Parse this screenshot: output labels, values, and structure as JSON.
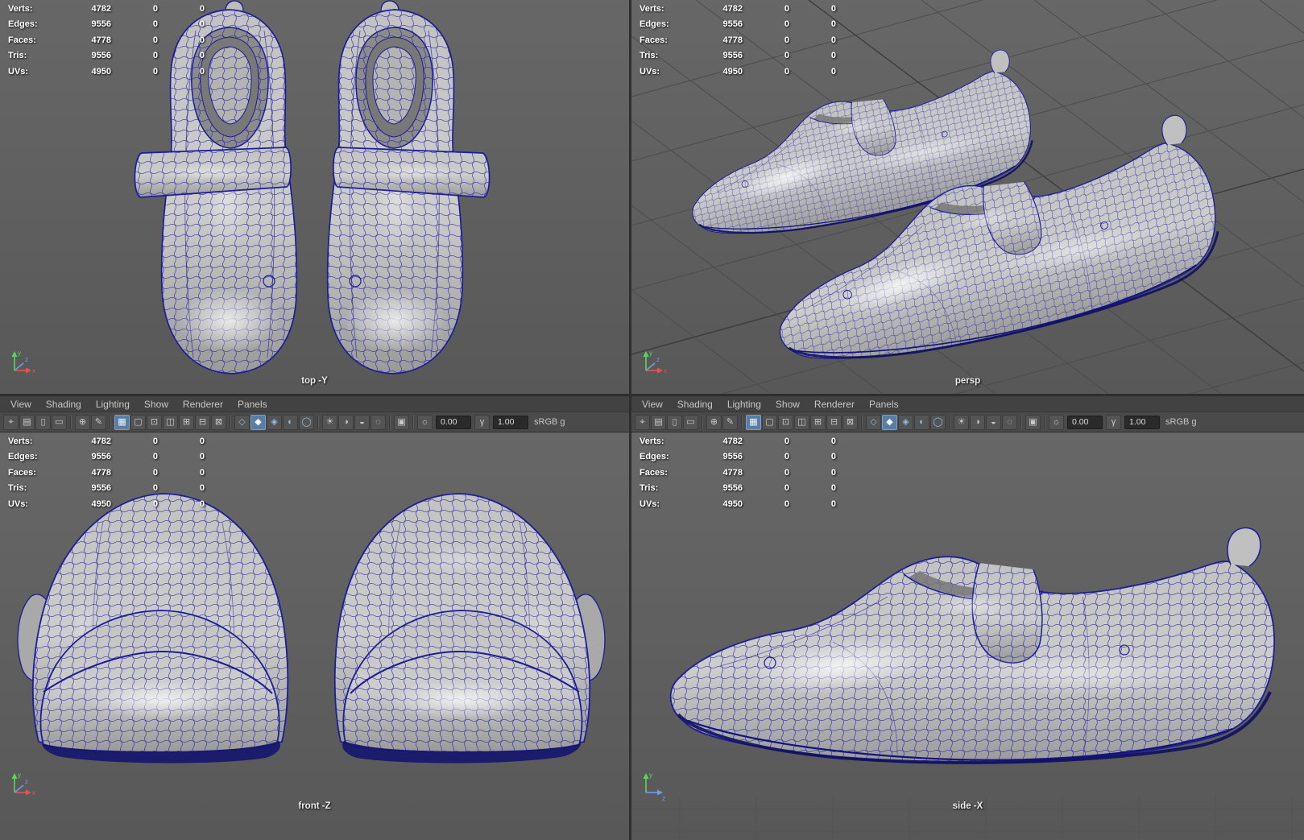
{
  "stats": {
    "rows": [
      {
        "label": "Verts:",
        "total": "4782",
        "selected": "0",
        "other": "0"
      },
      {
        "label": "Edges:",
        "total": "9556",
        "selected": "0",
        "other": "0"
      },
      {
        "label": "Faces:",
        "total": "4778",
        "selected": "0",
        "other": "0"
      },
      {
        "label": "Tris:",
        "total": "9556",
        "selected": "0",
        "other": "0"
      },
      {
        "label": "UVs:",
        "total": "4950",
        "selected": "0",
        "other": "0"
      }
    ]
  },
  "panel_menu": [
    "View",
    "Shading",
    "Lighting",
    "Show",
    "Renderer",
    "Panels"
  ],
  "toolbar": {
    "icons": [
      {
        "name": "select-camera-icon",
        "glyph": "⌖"
      },
      {
        "name": "camera-attributes-icon",
        "glyph": "▤"
      },
      {
        "name": "camera-bookmarks-icon",
        "glyph": "▯"
      },
      {
        "name": "image-plane-icon",
        "glyph": "▭"
      },
      {
        "sep": true
      },
      {
        "name": "two-d-pan-zoom-icon",
        "glyph": "⊕"
      },
      {
        "name": "grease-pencil-icon",
        "glyph": "✎"
      },
      {
        "sep": true
      },
      {
        "name": "grid-icon",
        "glyph": "▦",
        "active": true
      },
      {
        "name": "film-gate-icon",
        "glyph": "▢"
      },
      {
        "name": "resolution-gate-icon",
        "glyph": "⊡"
      },
      {
        "name": "gate-mask-icon",
        "glyph": "◫"
      },
      {
        "name": "field-chart-icon",
        "glyph": "⊞"
      },
      {
        "name": "safe-action-icon",
        "glyph": "⊟"
      },
      {
        "name": "safe-title-icon",
        "glyph": "⊠"
      },
      {
        "sep": true
      },
      {
        "name": "wireframe-icon",
        "glyph": "◇",
        "tint": true
      },
      {
        "name": "smooth-shade-icon",
        "glyph": "◆",
        "tint": true,
        "active": true
      },
      {
        "name": "wireframe-on-shaded-icon",
        "glyph": "◈",
        "tint": true
      },
      {
        "name": "textured-icon",
        "glyph": "◐",
        "tint": true
      },
      {
        "name": "use-default-material-icon",
        "glyph": "◯",
        "tint": true
      },
      {
        "sep": true
      },
      {
        "name": "all-lights-icon",
        "glyph": "☀"
      },
      {
        "name": "shadows-icon",
        "glyph": "◑"
      },
      {
        "name": "screen-space-ao-icon",
        "glyph": "◒"
      },
      {
        "name": "motion-blur-icon",
        "glyph": "◌"
      },
      {
        "sep": true
      },
      {
        "name": "isolate-select-icon",
        "glyph": "▣"
      },
      {
        "sep": true
      }
    ],
    "exposure_icon": "☼",
    "exposure": "0.00",
    "gamma_icon": "γ",
    "gamma": "1.00",
    "colorspace": "sRGB g"
  },
  "viewports": {
    "top": {
      "label": "top -Y"
    },
    "persp": {
      "label": "persp"
    },
    "front": {
      "label": "front -Z"
    },
    "side": {
      "label": "side -X"
    }
  },
  "axis": {
    "x": "x",
    "y": "y",
    "z": "z"
  },
  "colors": {
    "wireframe": "#1d1d95",
    "viewport_bg": "#5f5f5f",
    "menubar_bg": "#424242",
    "toolbar_bg": "#4a4a4a",
    "active_icon": "#5b7da2",
    "hud_text": "#ffffff"
  }
}
